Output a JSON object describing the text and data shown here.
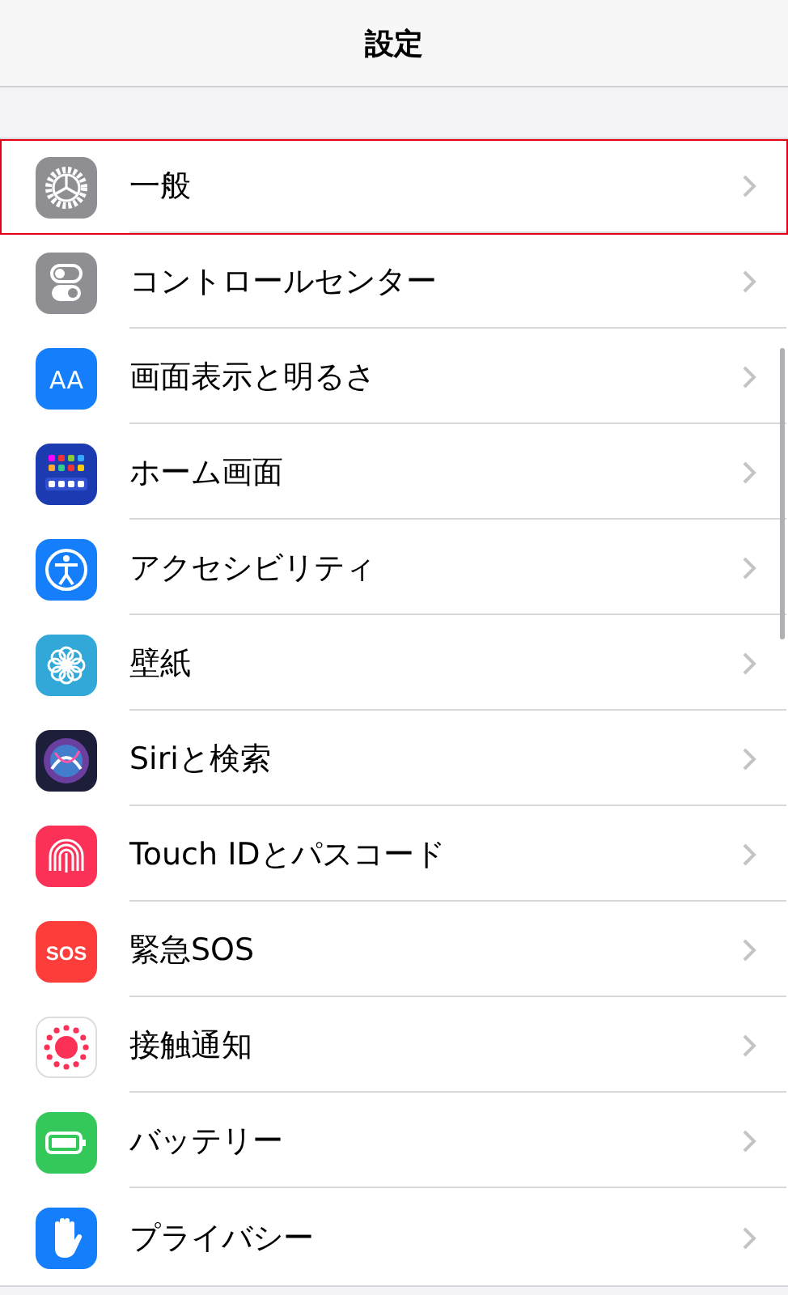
{
  "nav_bar": {
    "title": "設定"
  },
  "items": [
    {
      "label": "一般",
      "kind": "gear",
      "highlighted": true
    },
    {
      "label": "コントロールセンター",
      "kind": "toggles",
      "highlighted": false
    },
    {
      "label": "画面表示と明るさ",
      "kind": "text-size",
      "icon_text": "AA",
      "highlighted": false
    },
    {
      "label": "ホーム画面",
      "kind": "app-grid",
      "highlighted": false
    },
    {
      "label": "アクセシビリティ",
      "kind": "accessibility",
      "highlighted": false
    },
    {
      "label": "壁紙",
      "kind": "flower",
      "highlighted": false
    },
    {
      "label": "Siriと検索",
      "kind": "orb",
      "highlighted": false
    },
    {
      "label": "Touch IDとパスコード",
      "kind": "fingerprint",
      "highlighted": false
    },
    {
      "label": "緊急SOS",
      "kind": "sos",
      "icon_text": "SOS",
      "highlighted": false
    },
    {
      "label": "接触通知",
      "kind": "exposure",
      "highlighted": false
    },
    {
      "label": "バッテリー",
      "kind": "battery",
      "highlighted": false
    },
    {
      "label": "プライバシー",
      "kind": "hand",
      "highlighted": false
    }
  ]
}
